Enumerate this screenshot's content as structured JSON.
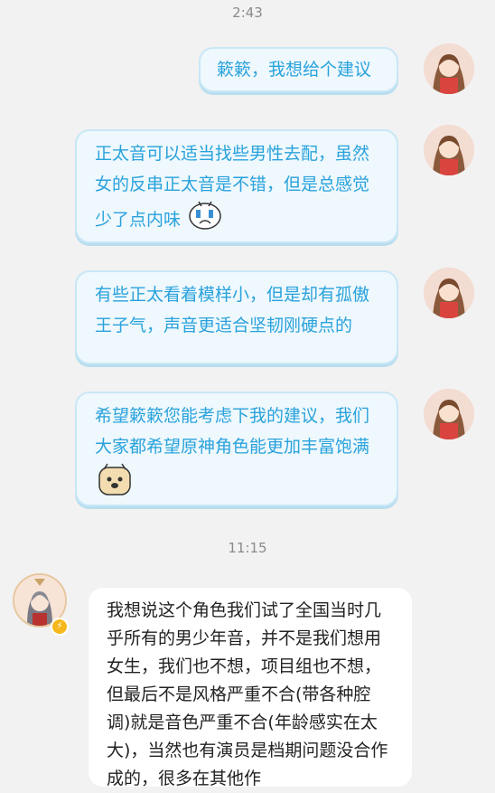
{
  "timestamps": [
    "2:43",
    "11:15"
  ],
  "messages_right": [
    {
      "text": "簌簌，我想给个建议"
    },
    {
      "text": "正太音可以适当找些男性去配，虽然女的反串正太音是不错，但是总感觉少了点内味"
    },
    {
      "text": "有些正太看着模样小，但是却有孤傲王子气，声音更适合坚韧刚硬点的"
    },
    {
      "text": "希望簌簌您能考虑下我的建议，我们大家都希望原神角色能更加丰富饱满"
    }
  ],
  "message_left": {
    "text": "我想说这个角色我们试了全国当时几乎所有的男少年音，并不是我们想用女生，我们也不想，项目组也不想，但最后不是风格严重不合(带各种腔调)就是音色严重不合(年龄感实在太大)，当然也有演员是档期问题没合作成的，很多在其他作"
  },
  "icons": {
    "sticker_cry": "crying-face-sticker",
    "sticker_dog": "dog-face-sticker",
    "badge": "lightning-badge-icon"
  },
  "colors": {
    "background": "#f2f2f2",
    "bubble_fill": "#eef8fd",
    "bubble_text": "#2aa2dc",
    "timestamp": "#8a8a8a"
  }
}
